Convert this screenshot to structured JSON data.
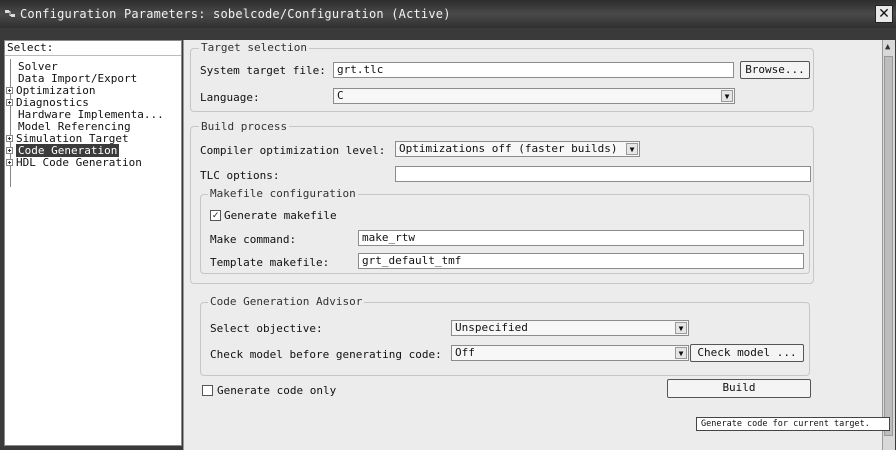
{
  "window": {
    "title": "Configuration Parameters: sobelcode/Configuration (Active)",
    "close_symbol": "✕"
  },
  "tree": {
    "header": "Select:",
    "items": [
      {
        "label": "Solver",
        "expandable": false,
        "selected": false
      },
      {
        "label": "Data Import/Export",
        "expandable": false,
        "selected": false
      },
      {
        "label": "Optimization",
        "expandable": true,
        "selected": false
      },
      {
        "label": "Diagnostics",
        "expandable": true,
        "selected": false
      },
      {
        "label": "Hardware Implementa...",
        "expandable": false,
        "selected": false
      },
      {
        "label": "Model Referencing",
        "expandable": false,
        "selected": false
      },
      {
        "label": "Simulation Target",
        "expandable": true,
        "selected": false
      },
      {
        "label": "Code Generation",
        "expandable": true,
        "selected": true
      },
      {
        "label": "HDL Code Generation",
        "expandable": true,
        "selected": false
      }
    ]
  },
  "target_selection": {
    "title": "Target selection",
    "system_target_label": "System target file:",
    "system_target_value": "grt.tlc",
    "browse_label": "Browse...",
    "language_label": "Language:",
    "language_value": "C"
  },
  "build_process": {
    "title": "Build process",
    "compiler_opt_label": "Compiler optimization level:",
    "compiler_opt_value": "Optimizations off (faster builds)",
    "tlc_options_label": "TLC options:",
    "tlc_options_value": "",
    "makefile": {
      "title": "Makefile configuration",
      "generate_makefile_label": "Generate makefile",
      "generate_makefile_checked": true,
      "make_command_label": "Make command:",
      "make_command_value": "make_rtw",
      "template_makefile_label": "Template makefile:",
      "template_makefile_value": "grt_default_tmf"
    }
  },
  "advisor": {
    "title": "Code Generation Advisor",
    "select_objective_label": "Select objective:",
    "select_objective_value": "Unspecified",
    "check_model_label": "Check model before generating code:",
    "check_model_value": "Off",
    "check_model_button": "Check model ..."
  },
  "generate_code_only_label": "Generate code only",
  "generate_code_only_checked": false,
  "build_button": "Build",
  "tooltip": "Generate code for current target."
}
